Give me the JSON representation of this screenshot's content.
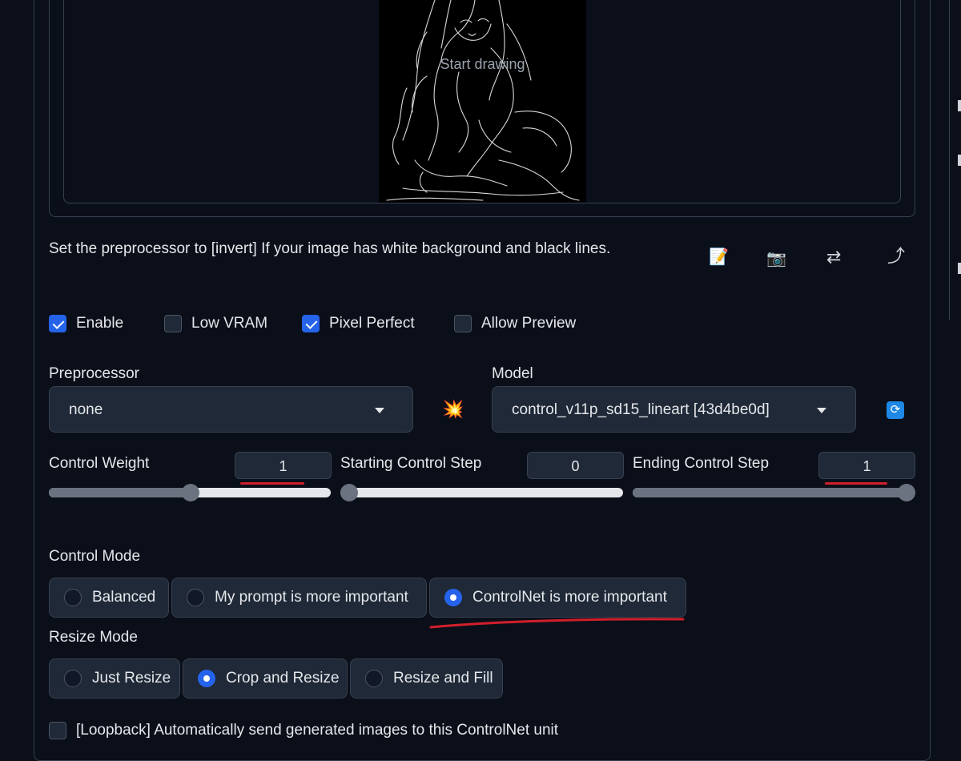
{
  "image_panel": {
    "placeholder": "Start drawing"
  },
  "hint_text": "Set the preprocessor to [invert] If your image has white background and black lines.",
  "tools": [
    {
      "icon": "memo-icon",
      "glyph": "📝"
    },
    {
      "icon": "camera-icon",
      "glyph": "📷"
    },
    {
      "icon": "swap-arrows-icon",
      "glyph": "⇄"
    },
    {
      "icon": "curved-arrow-icon",
      "glyph": "⤴"
    }
  ],
  "options": {
    "enable": {
      "label": "Enable",
      "checked": true
    },
    "low_vram": {
      "label": "Low VRAM",
      "checked": false
    },
    "pixel_perfect": {
      "label": "Pixel Perfect",
      "checked": true
    },
    "allow_preview": {
      "label": "Allow Preview",
      "checked": false
    }
  },
  "preprocessor": {
    "label": "Preprocessor",
    "value": "none"
  },
  "run_icon": {
    "icon": "explosion-icon",
    "glyph": "💥"
  },
  "model": {
    "label": "Model",
    "value": "control_v11p_sd15_lineart [43d4be0d]"
  },
  "sliders": {
    "control_weight": {
      "label": "Control Weight",
      "value": "1",
      "fraction": 0.5
    },
    "starting_step": {
      "label": "Starting Control Step",
      "value": "0",
      "fraction": 0
    },
    "ending_step": {
      "label": "Ending Control Step",
      "value": "1",
      "fraction": 1
    }
  },
  "control_mode": {
    "label": "Control Mode",
    "options": [
      "Balanced",
      "My prompt is more important",
      "ControlNet is more important"
    ],
    "selected": "ControlNet is more important"
  },
  "resize_mode": {
    "label": "Resize Mode",
    "options": [
      "Just Resize",
      "Crop and Resize",
      "Resize and Fill"
    ],
    "selected": "Crop and Resize"
  },
  "loopback": {
    "label": "[Loopback] Automatically send generated images to this ControlNet unit",
    "checked": false
  },
  "colors": {
    "background": "#0b0f19",
    "accent": "#2563eb",
    "annotation": "#d21f2b"
  }
}
